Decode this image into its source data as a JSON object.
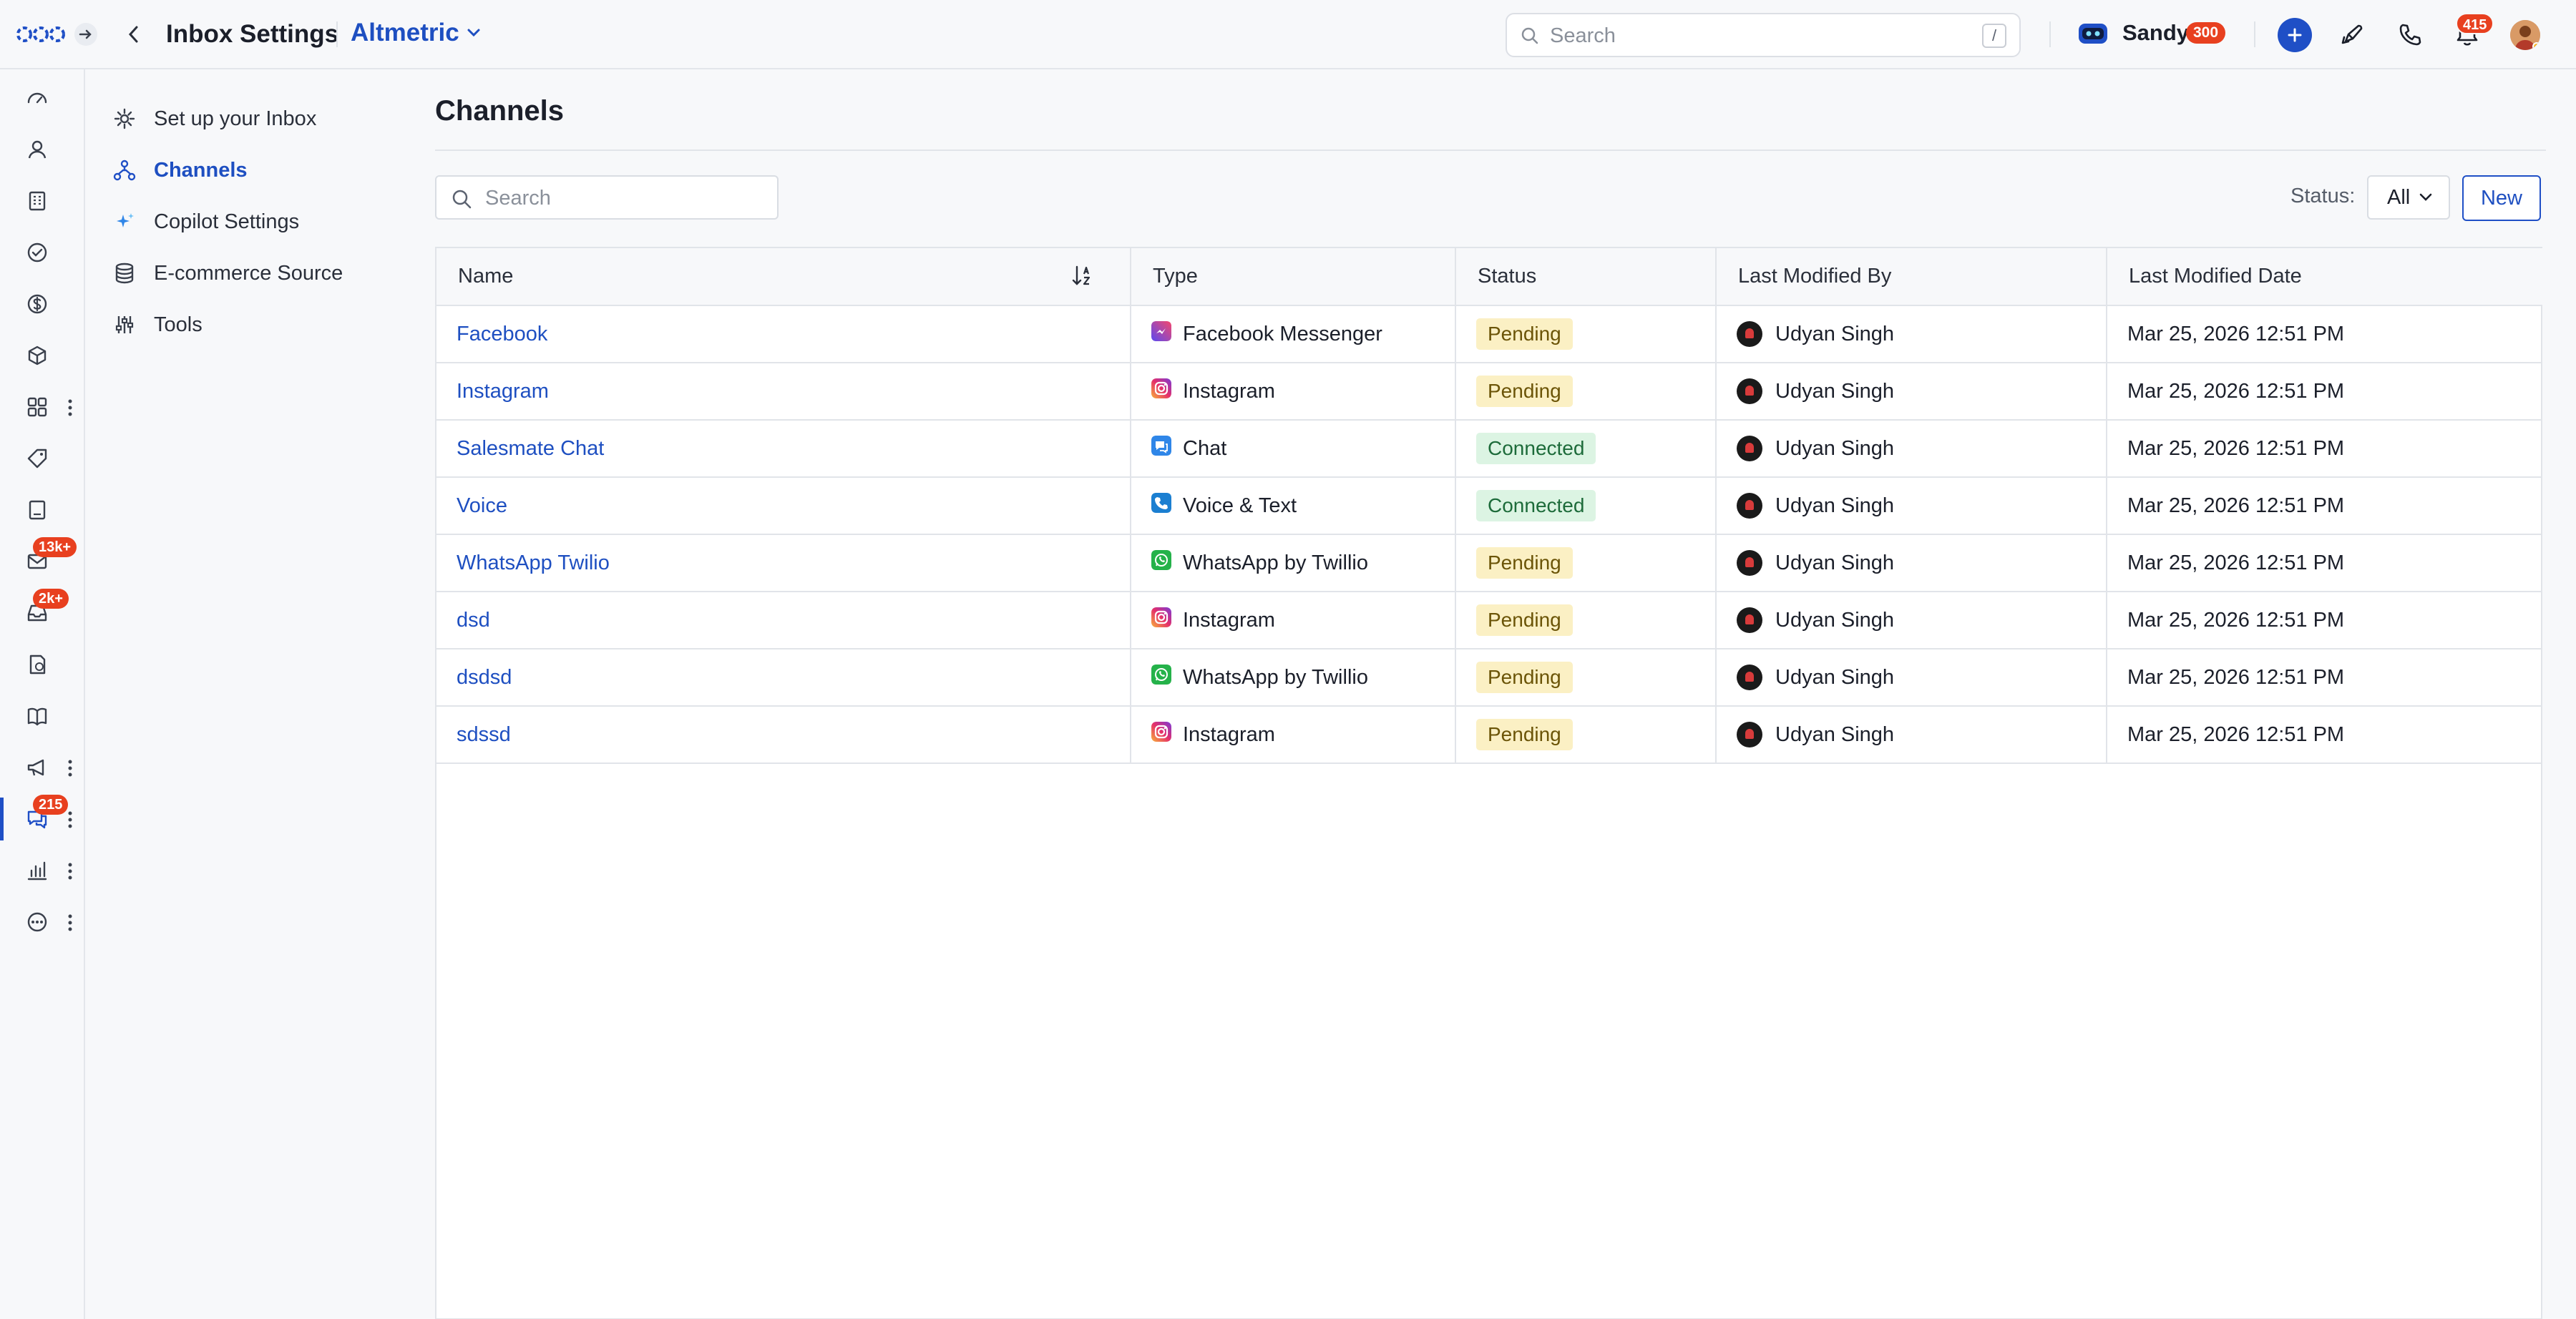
{
  "header": {
    "title": "Inbox Settings",
    "org_name": "Altmetric",
    "search_placeholder": "Search",
    "search_shortcut": "/",
    "user_name": "Sandy",
    "user_points": "300",
    "notifications_count": "415"
  },
  "rail": {
    "badges": {
      "email": "13k+",
      "inbox": "2k+",
      "conversations": "215"
    }
  },
  "subnav": {
    "items": [
      {
        "label": "Set up your Inbox",
        "icon": "gear-icon"
      },
      {
        "label": "Channels",
        "icon": "network-icon"
      },
      {
        "label": "Copilot Settings",
        "icon": "sparkle-icon"
      },
      {
        "label": "E-commerce Source",
        "icon": "database-icon"
      },
      {
        "label": "Tools",
        "icon": "tools-icon"
      }
    ]
  },
  "main": {
    "title": "Channels",
    "search_placeholder": "Search",
    "status_label": "Status:",
    "status_value": "All",
    "new_button": "New",
    "columns": [
      "Name",
      "Type",
      "Status",
      "Last Modified By",
      "Last Modified Date"
    ],
    "rows": [
      {
        "name": "Facebook",
        "type": "Facebook Messenger",
        "type_icon": "messenger-icon",
        "status": "Pending",
        "modified_by": "Udyan Singh",
        "modified_date": "Mar 25, 2026 12:51 PM"
      },
      {
        "name": "Instagram",
        "type": "Instagram",
        "type_icon": "instagram-icon",
        "status": "Pending",
        "modified_by": "Udyan Singh",
        "modified_date": "Mar 25, 2026 12:51 PM"
      },
      {
        "name": "Salesmate Chat",
        "type": "Chat",
        "type_icon": "chat-icon",
        "status": "Connected",
        "modified_by": "Udyan Singh",
        "modified_date": "Mar 25, 2026 12:51 PM"
      },
      {
        "name": "Voice",
        "type": "Voice & Text",
        "type_icon": "phone-icon",
        "status": "Connected",
        "modified_by": "Udyan Singh",
        "modified_date": "Mar 25, 2026 12:51 PM"
      },
      {
        "name": "WhatsApp Twilio",
        "type": "WhatsApp by Twillio",
        "type_icon": "whatsapp-icon",
        "status": "Pending",
        "modified_by": "Udyan Singh",
        "modified_date": "Mar 25, 2026 12:51 PM"
      },
      {
        "name": "dsd",
        "type": "Instagram",
        "type_icon": "instagram-icon",
        "status": "Pending",
        "modified_by": "Udyan Singh",
        "modified_date": "Mar 25, 2026 12:51 PM"
      },
      {
        "name": "dsdsd",
        "type": "WhatsApp by Twillio",
        "type_icon": "whatsapp-icon",
        "status": "Pending",
        "modified_by": "Udyan Singh",
        "modified_date": "Mar 25, 2026 12:51 PM"
      },
      {
        "name": "sdssd",
        "type": "Instagram",
        "type_icon": "instagram-icon",
        "status": "Pending",
        "modified_by": "Udyan Singh",
        "modified_date": "Mar 25, 2026 12:51 PM"
      }
    ]
  },
  "colors": {
    "accent": "#1f4fc6",
    "badge": "#e8401f",
    "pending_bg": "#fbf0c4",
    "connected_bg": "#dcf4e3"
  }
}
